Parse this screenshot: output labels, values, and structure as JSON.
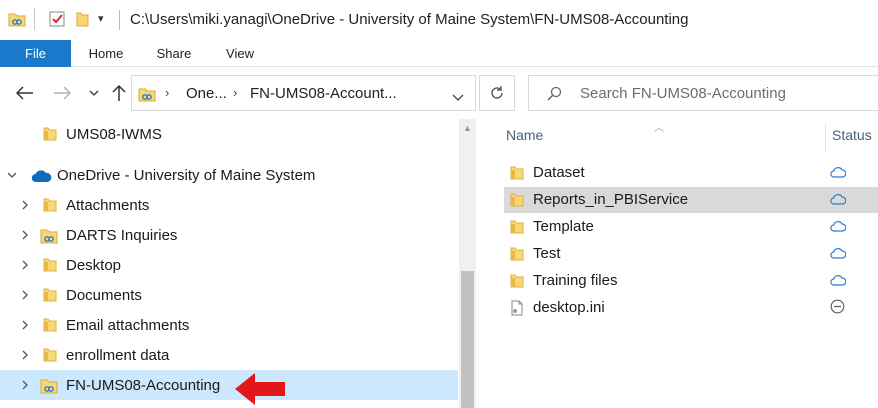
{
  "window": {
    "title": "C:\\Users\\miki.yanagi\\OneDrive - University of Maine System\\FN-UMS08-Accounting"
  },
  "ribbon": {
    "tabs": [
      {
        "label": "File"
      },
      {
        "label": "Home"
      },
      {
        "label": "Share"
      },
      {
        "label": "View"
      }
    ]
  },
  "address": {
    "segments": [
      "One...",
      "FN-UMS08-Account..."
    ]
  },
  "search": {
    "placeholder": "Search FN-UMS08-Accounting"
  },
  "nav": {
    "items": [
      {
        "label": "UMS08-IWMS",
        "icon": "folder-icon"
      },
      {
        "label": "OneDrive - University of Maine System",
        "icon": "onedrive-cloud-icon",
        "expanded": true
      },
      {
        "label": "Attachments",
        "icon": "folder-icon"
      },
      {
        "label": "DARTS Inquiries",
        "icon": "shared-folder-icon"
      },
      {
        "label": "Desktop",
        "icon": "folder-icon"
      },
      {
        "label": "Documents",
        "icon": "folder-icon"
      },
      {
        "label": "Email attachments",
        "icon": "folder-icon"
      },
      {
        "label": "enrollment data",
        "icon": "folder-icon"
      },
      {
        "label": "FN-UMS08-Accounting",
        "icon": "shared-folder-icon",
        "selected": true
      }
    ]
  },
  "content": {
    "columns": {
      "name": "Name",
      "status": "Status"
    },
    "files": [
      {
        "name": "Dataset",
        "icon": "folder-icon",
        "status": "cloud-icon"
      },
      {
        "name": "Reports_in_PBIService",
        "icon": "folder-icon",
        "status": "cloud-icon",
        "hover": true
      },
      {
        "name": "Template",
        "icon": "folder-icon",
        "status": "cloud-icon"
      },
      {
        "name": "Test",
        "icon": "folder-icon",
        "status": "cloud-icon"
      },
      {
        "name": "Training files",
        "icon": "folder-icon",
        "status": "cloud-icon"
      },
      {
        "name": "desktop.ini",
        "icon": "ini-file-icon",
        "status": "excluded-icon"
      }
    ]
  },
  "colors": {
    "accent": "#1979ca",
    "selection": "#cce8ff",
    "hover": "#d9d9d9",
    "folder": "#f8d775",
    "folder_dark": "#e0b13f",
    "cloud": "#2a7bd4",
    "annotation_arrow": "#e3171b"
  }
}
